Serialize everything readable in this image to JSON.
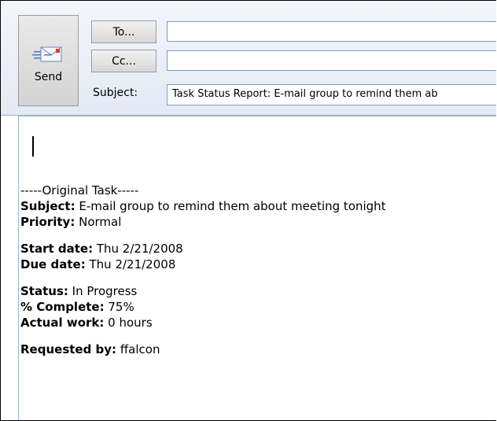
{
  "compose": {
    "send_label": "Send",
    "to_button_label": "To...",
    "cc_button_label": "Cc...",
    "subject_label": "Subject:",
    "to_value": "",
    "cc_value": "",
    "subject_value": "Task Status Report: E-mail group to remind them ab",
    "send_icon": "envelope-send-icon"
  },
  "body": {
    "separator": "-----Original Task-----",
    "subject_key": "Subject:",
    "subject_val": " E-mail group to remind them about meeting tonight",
    "priority_key": "Priority:",
    "priority_val": " Normal",
    "start_key": "Start date:",
    "start_val": " Thu 2/21/2008",
    "due_key": "Due date:",
    "due_val": " Thu 2/21/2008",
    "status_key": "Status:",
    "status_val": " In Progress",
    "complete_key": "% Complete:",
    "complete_val": " 75%",
    "work_key": "Actual work:",
    "work_val": " 0 hours",
    "requested_key": "Requested by:",
    "requested_val": " ffalcon"
  }
}
